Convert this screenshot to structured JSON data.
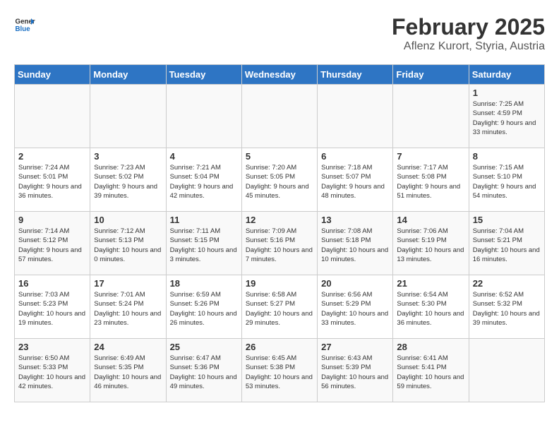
{
  "header": {
    "logo_line1": "General",
    "logo_line2": "Blue",
    "month_year": "February 2025",
    "location": "Aflenz Kurort, Styria, Austria"
  },
  "days_of_week": [
    "Sunday",
    "Monday",
    "Tuesday",
    "Wednesday",
    "Thursday",
    "Friday",
    "Saturday"
  ],
  "weeks": [
    [
      {
        "day": "",
        "info": ""
      },
      {
        "day": "",
        "info": ""
      },
      {
        "day": "",
        "info": ""
      },
      {
        "day": "",
        "info": ""
      },
      {
        "day": "",
        "info": ""
      },
      {
        "day": "",
        "info": ""
      },
      {
        "day": "1",
        "info": "Sunrise: 7:25 AM\nSunset: 4:59 PM\nDaylight: 9 hours and 33 minutes."
      }
    ],
    [
      {
        "day": "2",
        "info": "Sunrise: 7:24 AM\nSunset: 5:01 PM\nDaylight: 9 hours and 36 minutes."
      },
      {
        "day": "3",
        "info": "Sunrise: 7:23 AM\nSunset: 5:02 PM\nDaylight: 9 hours and 39 minutes."
      },
      {
        "day": "4",
        "info": "Sunrise: 7:21 AM\nSunset: 5:04 PM\nDaylight: 9 hours and 42 minutes."
      },
      {
        "day": "5",
        "info": "Sunrise: 7:20 AM\nSunset: 5:05 PM\nDaylight: 9 hours and 45 minutes."
      },
      {
        "day": "6",
        "info": "Sunrise: 7:18 AM\nSunset: 5:07 PM\nDaylight: 9 hours and 48 minutes."
      },
      {
        "day": "7",
        "info": "Sunrise: 7:17 AM\nSunset: 5:08 PM\nDaylight: 9 hours and 51 minutes."
      },
      {
        "day": "8",
        "info": "Sunrise: 7:15 AM\nSunset: 5:10 PM\nDaylight: 9 hours and 54 minutes."
      }
    ],
    [
      {
        "day": "9",
        "info": "Sunrise: 7:14 AM\nSunset: 5:12 PM\nDaylight: 9 hours and 57 minutes."
      },
      {
        "day": "10",
        "info": "Sunrise: 7:12 AM\nSunset: 5:13 PM\nDaylight: 10 hours and 0 minutes."
      },
      {
        "day": "11",
        "info": "Sunrise: 7:11 AM\nSunset: 5:15 PM\nDaylight: 10 hours and 3 minutes."
      },
      {
        "day": "12",
        "info": "Sunrise: 7:09 AM\nSunset: 5:16 PM\nDaylight: 10 hours and 7 minutes."
      },
      {
        "day": "13",
        "info": "Sunrise: 7:08 AM\nSunset: 5:18 PM\nDaylight: 10 hours and 10 minutes."
      },
      {
        "day": "14",
        "info": "Sunrise: 7:06 AM\nSunset: 5:19 PM\nDaylight: 10 hours and 13 minutes."
      },
      {
        "day": "15",
        "info": "Sunrise: 7:04 AM\nSunset: 5:21 PM\nDaylight: 10 hours and 16 minutes."
      }
    ],
    [
      {
        "day": "16",
        "info": "Sunrise: 7:03 AM\nSunset: 5:23 PM\nDaylight: 10 hours and 19 minutes."
      },
      {
        "day": "17",
        "info": "Sunrise: 7:01 AM\nSunset: 5:24 PM\nDaylight: 10 hours and 23 minutes."
      },
      {
        "day": "18",
        "info": "Sunrise: 6:59 AM\nSunset: 5:26 PM\nDaylight: 10 hours and 26 minutes."
      },
      {
        "day": "19",
        "info": "Sunrise: 6:58 AM\nSunset: 5:27 PM\nDaylight: 10 hours and 29 minutes."
      },
      {
        "day": "20",
        "info": "Sunrise: 6:56 AM\nSunset: 5:29 PM\nDaylight: 10 hours and 33 minutes."
      },
      {
        "day": "21",
        "info": "Sunrise: 6:54 AM\nSunset: 5:30 PM\nDaylight: 10 hours and 36 minutes."
      },
      {
        "day": "22",
        "info": "Sunrise: 6:52 AM\nSunset: 5:32 PM\nDaylight: 10 hours and 39 minutes."
      }
    ],
    [
      {
        "day": "23",
        "info": "Sunrise: 6:50 AM\nSunset: 5:33 PM\nDaylight: 10 hours and 42 minutes."
      },
      {
        "day": "24",
        "info": "Sunrise: 6:49 AM\nSunset: 5:35 PM\nDaylight: 10 hours and 46 minutes."
      },
      {
        "day": "25",
        "info": "Sunrise: 6:47 AM\nSunset: 5:36 PM\nDaylight: 10 hours and 49 minutes."
      },
      {
        "day": "26",
        "info": "Sunrise: 6:45 AM\nSunset: 5:38 PM\nDaylight: 10 hours and 53 minutes."
      },
      {
        "day": "27",
        "info": "Sunrise: 6:43 AM\nSunset: 5:39 PM\nDaylight: 10 hours and 56 minutes."
      },
      {
        "day": "28",
        "info": "Sunrise: 6:41 AM\nSunset: 5:41 PM\nDaylight: 10 hours and 59 minutes."
      },
      {
        "day": "",
        "info": ""
      }
    ]
  ]
}
